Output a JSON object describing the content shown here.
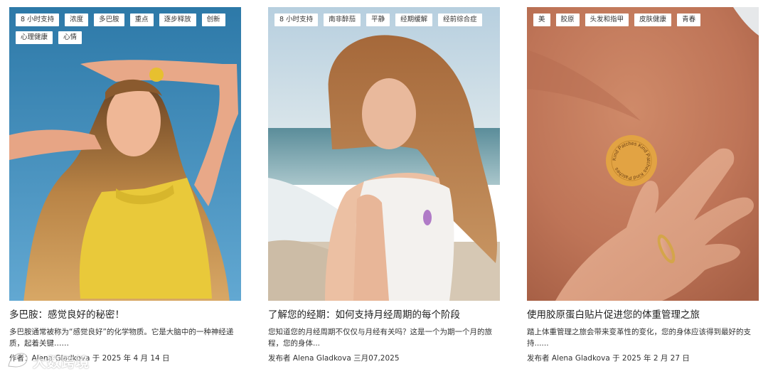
{
  "cards": [
    {
      "tags": [
        "8 小时支持",
        "浓度",
        "多巴胺",
        "重点",
        "逐步释放",
        "创新",
        "心理健康",
        "心情"
      ],
      "title": "多巴胺：感觉良好的秘密！",
      "excerpt": "多巴胺通常被称为“感觉良好”的化学物质。它是大脑中的一种神经递质，起着关键……",
      "meta": "作者：Alena Gladkova 于 2025 年 4 月 14 日",
      "image_icon": "woman-yellow-top-photo"
    },
    {
      "tags": [
        "8 小时支持",
        "南非醉茄",
        "平静",
        "经期缓解",
        "经前综合症"
      ],
      "title": "了解您的经期：如何支持月经周期的每个阶段",
      "excerpt": "您知道您的月经周期不仅仅与月经有关吗？这是一个为期一个月的旅程，您的身体...",
      "meta": "发布者 Alena Gladkova 三月07,2025",
      "image_icon": "woman-beach-photo"
    },
    {
      "tags": [
        "美",
        "胶原",
        "头发和指甲",
        "皮肤健康",
        "青春"
      ],
      "title": "使用胶原蛋白贴片促进您的体重管理之旅",
      "excerpt": "踏上体重管理之旅会带来变革性的变化，您的身体应该得到最好的支持......",
      "meta": "发布者 Alena Gladkova 于 2025 年 2 月 27 日",
      "image_icon": "collagen-patch-photo",
      "patch_text": "Kind Patches"
    }
  ],
  "watermark": {
    "text": "大数跨境"
  }
}
